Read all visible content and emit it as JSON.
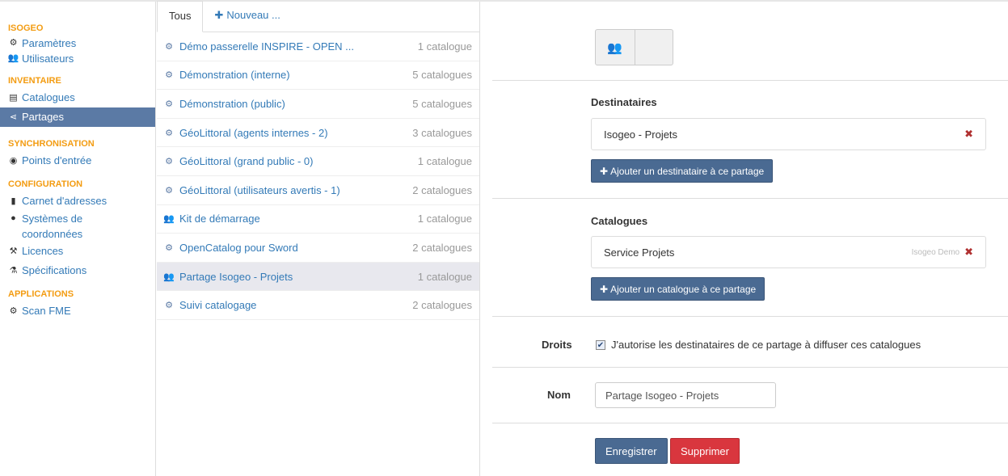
{
  "sidebar": {
    "sections": [
      {
        "title": "ISOGEO",
        "items": [
          {
            "label": "Paramètres",
            "icon": "gears-icon"
          },
          {
            "label": "Utilisateurs",
            "icon": "users-icon"
          }
        ]
      },
      {
        "title": "INVENTAIRE",
        "items": [
          {
            "label": "Catalogues",
            "icon": "list-icon"
          },
          {
            "label": "Partages",
            "icon": "share-icon",
            "active": true
          }
        ]
      },
      {
        "title": "SYNCHRONISATION",
        "items": [
          {
            "label": "Points d'entrée",
            "icon": "eye-icon"
          }
        ]
      },
      {
        "title": "CONFIGURATION",
        "items": [
          {
            "label": "Carnet d'adresses",
            "icon": "book-icon"
          },
          {
            "label": "Systèmes de coordonnées",
            "icon": "globe-icon"
          },
          {
            "label": "Licences",
            "icon": "gavel-icon"
          },
          {
            "label": "Spécifications",
            "icon": "flask-icon"
          }
        ]
      },
      {
        "title": "APPLICATIONS",
        "items": [
          {
            "label": "Scan FME",
            "icon": "cog-icon"
          }
        ]
      }
    ]
  },
  "tabs": {
    "all_label": "Tous",
    "new_label": "Nouveau ..."
  },
  "shares": [
    {
      "name": "Démo passerelle INSPIRE - OPEN ...",
      "count": "1 catalogue",
      "icon": "gears-icon"
    },
    {
      "name": "Démonstration (interne)",
      "count": "5 catalogues",
      "icon": "gears-icon"
    },
    {
      "name": "Démonstration (public)",
      "count": "5 catalogues",
      "icon": "gears-icon"
    },
    {
      "name": "GéoLittoral (agents internes - 2)",
      "count": "3 catalogues",
      "icon": "gears-icon"
    },
    {
      "name": "GéoLittoral (grand public - 0)",
      "count": "1 catalogue",
      "icon": "gears-icon"
    },
    {
      "name": "GéoLittoral (utilisateurs avertis - 1)",
      "count": "2 catalogues",
      "icon": "gears-icon"
    },
    {
      "name": "Kit de démarrage",
      "count": "1 catalogue",
      "icon": "users-icon"
    },
    {
      "name": "OpenCatalog pour Sword",
      "count": "2 catalogues",
      "icon": "gears-icon"
    },
    {
      "name": "Partage Isogeo - Projets",
      "count": "1 catalogue",
      "icon": "users-icon",
      "selected": true
    },
    {
      "name": "Suivi catalogage",
      "count": "2 catalogues",
      "icon": "gears-icon"
    }
  ],
  "detail": {
    "recipients_title": "Destinataires",
    "recipient": "Isogeo - Projets",
    "add_recipient": "Ajouter un destinataire à ce partage",
    "catalogs_title": "Catalogues",
    "catalog": "Service Projets",
    "catalog_owner": "Isogeo Demo",
    "add_catalog": "Ajouter un catalogue à ce partage",
    "rights_label": "Droits",
    "rights_text": "J'autorise les destinataires de ce partage à diffuser ces catalogues",
    "rights_checked": true,
    "name_label": "Nom",
    "name_value": "Partage Isogeo - Projets",
    "save_label": "Enregistrer",
    "delete_label": "Supprimer"
  }
}
